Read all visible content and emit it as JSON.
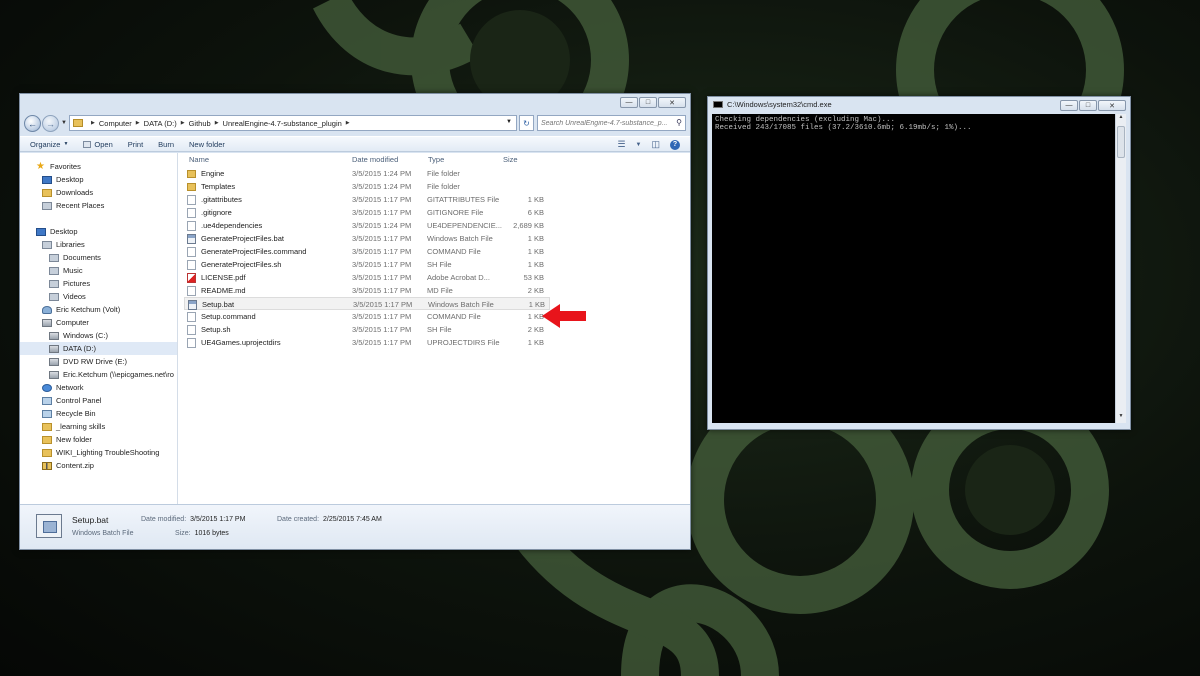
{
  "explorer": {
    "breadcrumbs": [
      "Computer",
      "DATA (D:)",
      "Github",
      "UnrealEngine-4.7-substance_plugin"
    ],
    "search_placeholder": "Search UnrealEngine-4.7-substance_p...",
    "toolbar": {
      "organize": "Organize",
      "open": "Open",
      "print": "Print",
      "burn": "Burn",
      "new_folder": "New folder"
    },
    "nav": [
      {
        "label": "Favorites",
        "icon": "star-icon"
      },
      {
        "label": "Desktop",
        "icon": "desktop-icon"
      },
      {
        "label": "Downloads",
        "icon": "downloads-icon"
      },
      {
        "label": "Recent Places",
        "icon": "recent-places-icon"
      },
      {
        "label": "Desktop",
        "icon": "desktop-icon"
      },
      {
        "label": "Libraries",
        "icon": "libraries-icon"
      },
      {
        "label": "Documents",
        "icon": "documents-icon"
      },
      {
        "label": "Music",
        "icon": "music-icon"
      },
      {
        "label": "Pictures",
        "icon": "pictures-icon"
      },
      {
        "label": "Videos",
        "icon": "videos-icon"
      },
      {
        "label": "Eric Ketchum (Volt)",
        "icon": "user-icon"
      },
      {
        "label": "Computer",
        "icon": "computer-icon"
      },
      {
        "label": "Windows (C:)",
        "icon": "drive-icon"
      },
      {
        "label": "DATA (D:)",
        "icon": "drive-icon"
      },
      {
        "label": "DVD RW Drive (E:)",
        "icon": "dvd-drive-icon"
      },
      {
        "label": "Eric.Ketchum (\\\\epicgames.net\\ro",
        "icon": "network-drive-icon"
      },
      {
        "label": "Network",
        "icon": "network-icon"
      },
      {
        "label": "Control Panel",
        "icon": "control-panel-icon"
      },
      {
        "label": "Recycle Bin",
        "icon": "recycle-bin-icon"
      },
      {
        "label": "_learning skills",
        "icon": "folder-icon"
      },
      {
        "label": "New folder",
        "icon": "folder-icon"
      },
      {
        "label": "WIKI_Lighting TroubleShooting",
        "icon": "folder-icon"
      },
      {
        "label": "Content.zip",
        "icon": "zip-icon"
      }
    ],
    "columns": {
      "name": "Name",
      "date": "Date modified",
      "type": "Type",
      "size": "Size"
    },
    "files": [
      {
        "name": "Engine",
        "date": "3/5/2015 1:24 PM",
        "type": "File folder",
        "size": "",
        "icon": "folder-icon"
      },
      {
        "name": "Templates",
        "date": "3/5/2015 1:24 PM",
        "type": "File folder",
        "size": "",
        "icon": "folder-icon"
      },
      {
        "name": ".gitattributes",
        "date": "3/5/2015 1:17 PM",
        "type": "GITATTRIBUTES File",
        "size": "1 KB",
        "icon": "file-icon"
      },
      {
        "name": ".gitignore",
        "date": "3/5/2015 1:17 PM",
        "type": "GITIGNORE File",
        "size": "6 KB",
        "icon": "file-icon"
      },
      {
        "name": ".ue4dependencies",
        "date": "3/5/2015 1:24 PM",
        "type": "UE4DEPENDENCIE...",
        "size": "2,689 KB",
        "icon": "file-icon"
      },
      {
        "name": "GenerateProjectFiles.bat",
        "date": "3/5/2015 1:17 PM",
        "type": "Windows Batch File",
        "size": "1 KB",
        "icon": "batch-file-icon"
      },
      {
        "name": "GenerateProjectFiles.command",
        "date": "3/5/2015 1:17 PM",
        "type": "COMMAND File",
        "size": "1 KB",
        "icon": "file-icon"
      },
      {
        "name": "GenerateProjectFiles.sh",
        "date": "3/5/2015 1:17 PM",
        "type": "SH File",
        "size": "1 KB",
        "icon": "file-icon"
      },
      {
        "name": "LICENSE.pdf",
        "date": "3/5/2015 1:17 PM",
        "type": "Adobe Acrobat D...",
        "size": "53 KB",
        "icon": "pdf-icon"
      },
      {
        "name": "README.md",
        "date": "3/5/2015 1:17 PM",
        "type": "MD File",
        "size": "2 KB",
        "icon": "file-icon"
      },
      {
        "name": "Setup.bat",
        "date": "3/5/2015 1:17 PM",
        "type": "Windows Batch File",
        "size": "1 KB",
        "icon": "batch-file-icon",
        "selected": true
      },
      {
        "name": "Setup.command",
        "date": "3/5/2015 1:17 PM",
        "type": "COMMAND File",
        "size": "1 KB",
        "icon": "file-icon"
      },
      {
        "name": "Setup.sh",
        "date": "3/5/2015 1:17 PM",
        "type": "SH File",
        "size": "2 KB",
        "icon": "file-icon"
      },
      {
        "name": "UE4Games.uprojectdirs",
        "date": "3/5/2015 1:17 PM",
        "type": "UPROJECTDIRS File",
        "size": "1 KB",
        "icon": "file-icon"
      }
    ],
    "details": {
      "name": "Setup.bat",
      "type": "Windows Batch File",
      "modified_label": "Date modified:",
      "modified": "3/5/2015 1:17 PM",
      "created_label": "Date created:",
      "created": "2/25/2015 7:45 AM",
      "size_label": "Size:",
      "size": "1016 bytes"
    }
  },
  "cmd": {
    "title": "C:\\Windows\\system32\\cmd.exe",
    "lines": [
      "Checking dependencies (excluding Mac)...",
      "Received 243/17085 files (37.2/3610.6mb; 6.19mb/s; 1%)..."
    ]
  },
  "colors": {
    "annotation_arrow": "#e8141b",
    "selection": "#dfe9f6"
  }
}
